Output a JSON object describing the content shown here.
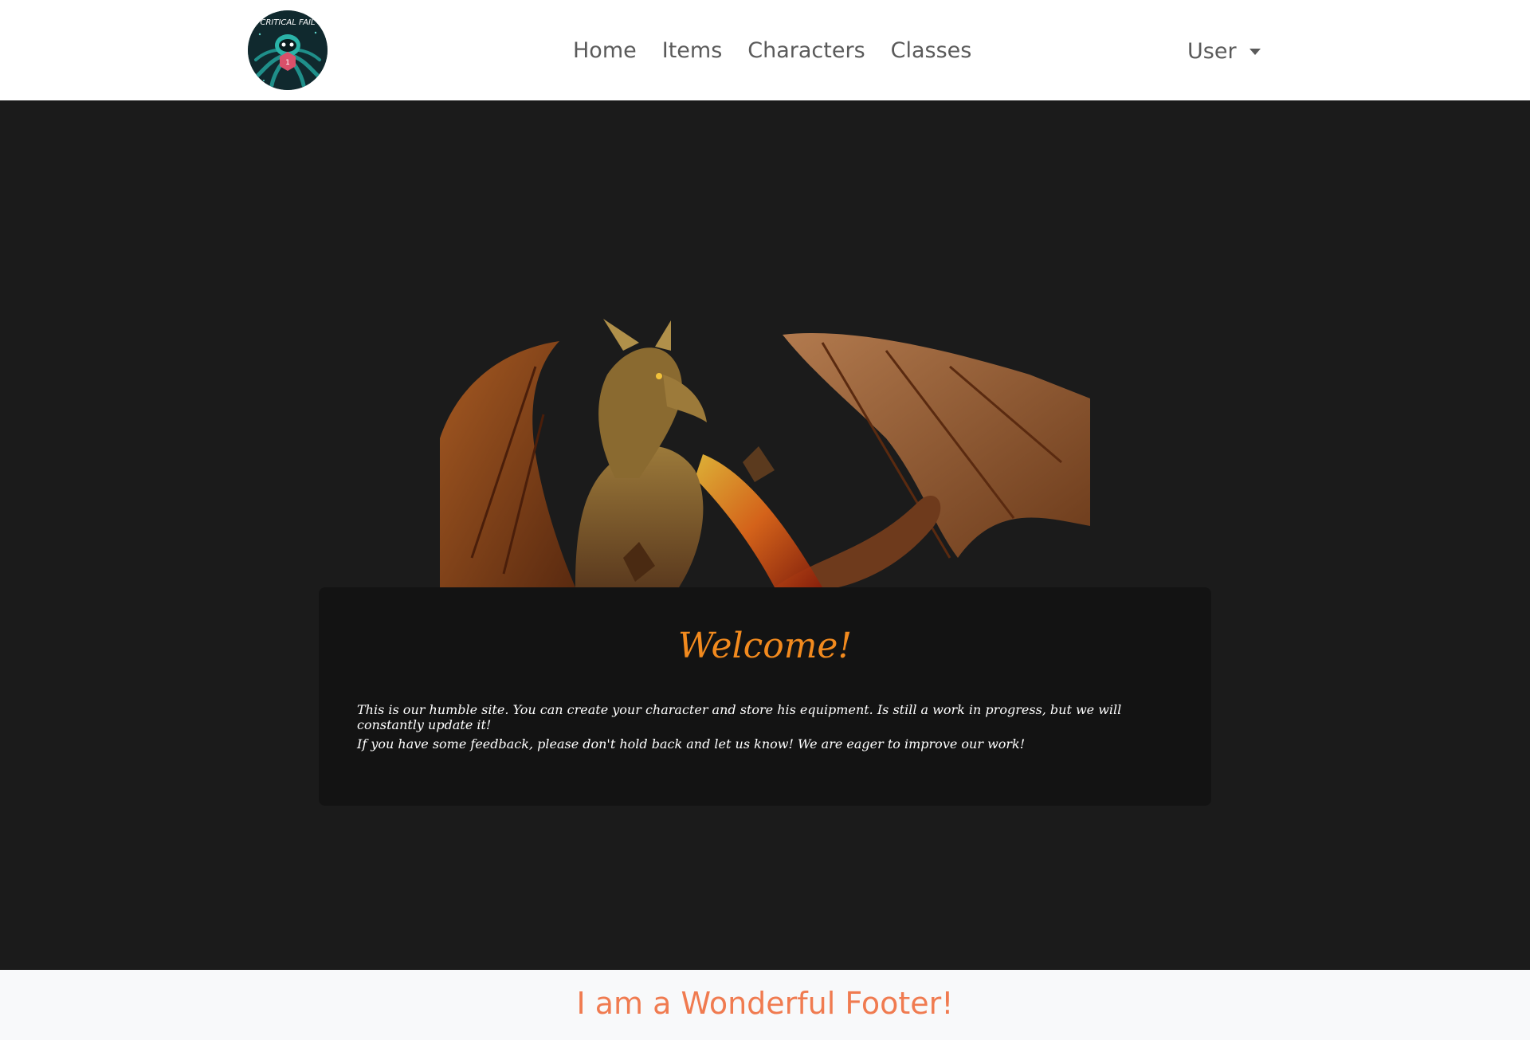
{
  "brand": {
    "logo_text": "CRITICAL FAIL"
  },
  "nav": {
    "links": [
      "Home",
      "Items",
      "Characters",
      "Classes"
    ],
    "user_menu": "User"
  },
  "hero": {
    "image": "dragon-illustration"
  },
  "welcome": {
    "title": "Welcome!",
    "paragraph1": "This is our humble site. You can create your character and store his equipment. Is still a work in progress, but we will constantly update it!",
    "paragraph2": "If you have some feedback, please don't hold back and let us know! We are eager to improve our work!"
  },
  "footer": {
    "text": "I am a Wonderful Footer!"
  },
  "colors": {
    "accent": "#f28a1e",
    "footer_accent": "#f07b50",
    "background": "#1b1b1b",
    "card": "#131313"
  }
}
